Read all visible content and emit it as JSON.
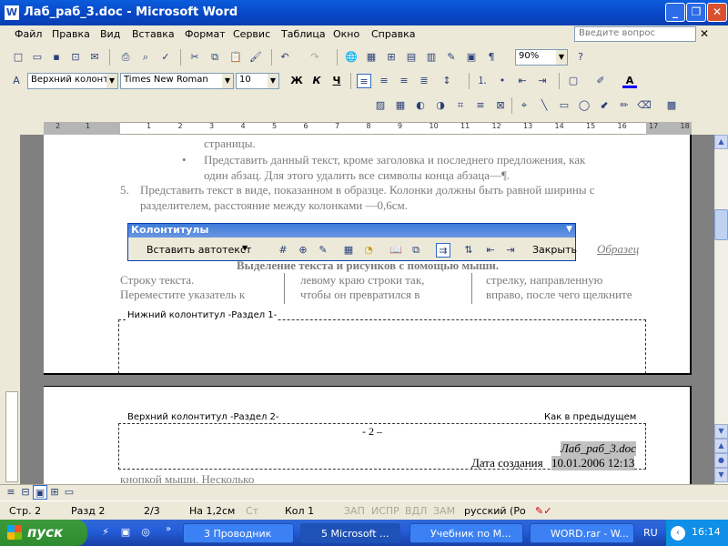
{
  "window": {
    "title": "Лаб_раб_3.doc - Microsoft Word"
  },
  "menubar": {
    "items": [
      "Файл",
      "Правка",
      "Вид",
      "Вставка",
      "Формат",
      "Сервис",
      "Таблица",
      "Окно",
      "Справка"
    ],
    "help_placeholder": "Введите вопрос"
  },
  "toolbar": {
    "zoom": "90%",
    "style": "Верхний колонт",
    "font": "Times New Roman",
    "size": "10",
    "bold": "Ж",
    "italic": "К",
    "underline": "Ч"
  },
  "ruler": {
    "numbers": [
      "2",
      "1",
      "1",
      "2",
      "3",
      "4",
      "5",
      "6",
      "7",
      "8",
      "9",
      "10",
      "11",
      "12",
      "13",
      "14",
      "15",
      "16",
      "17",
      "18"
    ]
  },
  "page1": {
    "line1": "страницы.",
    "bullet_line1": "Представить данный текст, кроме заголовка и последнего предложения, как",
    "bullet_line2": "один абзац. Для этого удалить все символы конца абзаца—¶.",
    "item5_num": "5.",
    "item5_line1": "Представить текст в виде, показанном в образце. Колонки должны быть равной ширины с",
    "item5_line2": "разделителем, расстояние между колонками —0,6см.",
    "sample_label": "Образец",
    "heading": "Выделение текста и рисунков с помощью мыши.",
    "col1_line1": "Строку        текста.",
    "col1_line2": "Переместите   указатель   к",
    "col2_line1": "левому краю строки так,",
    "col2_line2": "чтобы   он   превратился   в",
    "col3_line1": "стрелку,      направленную",
    "col3_line2": "вправо, после чего щелкните",
    "footer_label": "Нижний колонтитул -Раздел 1-"
  },
  "page2": {
    "header_label": "Верхний колонтитул -Раздел 2-",
    "same_as_prev": "Как в предыдущем",
    "page_num": "- 2 –",
    "filename": "Лаб_раб_3.doc",
    "created_label": "Дата создания",
    "created_value": "10.01.2006 12:13",
    "body_fragment": "кнопкой   мыши.   Несколько"
  },
  "kolontituly": {
    "title": "Колонтитулы",
    "insert_autotext": "Вставить автотекст",
    "close": "Закрыть"
  },
  "status": {
    "page": "Стр. 2",
    "section": "Разд 2",
    "pages": "2/3",
    "at": "На 1,2см",
    "line": "Ст",
    "col": "Кол 1",
    "rec": "ЗАП",
    "trk": "ИСПР",
    "ext": "ВДЛ",
    "ovr": "ЗАМ",
    "lang": "русский (Ро"
  },
  "taskbar": {
    "start": "пуск",
    "tasks": [
      "3 Проводник",
      "5 Microsoft ...",
      "Учебник по М...",
      "WORD.rar - W..."
    ],
    "lang": "RU",
    "time": "16:14"
  },
  "colors": {
    "titlebar": "#0a4fcc",
    "taskbar": "#245edb",
    "start": "#3c9a3c"
  }
}
